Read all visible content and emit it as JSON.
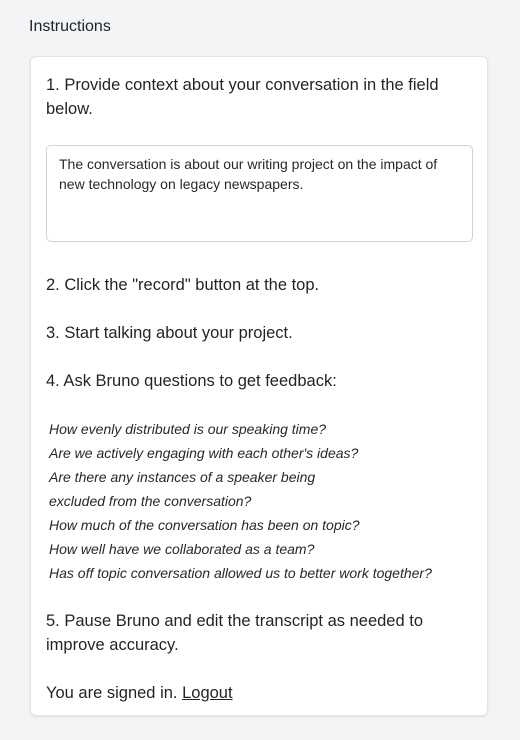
{
  "section": {
    "title": "Instructions"
  },
  "steps": {
    "step1": "1. Provide context about your conversation in the field below.",
    "context_value": "The conversation is about our writing project on the impact of new technology on legacy newspapers.",
    "step2": "2. Click the \"record\" button at the top.",
    "step3": "3. Start talking about your project.",
    "step4": "4. Ask Bruno questions to get feedback:",
    "questions": [
      "How evenly distributed is our speaking time?",
      "Are we actively engaging with each other's ideas?",
      "Are there any instances of a speaker being",
      "excluded from the conversation?",
      "How much of the conversation has been on topic?",
      "How well have we collaborated as a team?",
      "Has off topic conversation allowed us to better work together?"
    ],
    "step5": "5. Pause Bruno and edit the transcript as needed to improve accuracy."
  },
  "auth": {
    "status_text": "You are signed in.",
    "logout_label": "Logout"
  }
}
